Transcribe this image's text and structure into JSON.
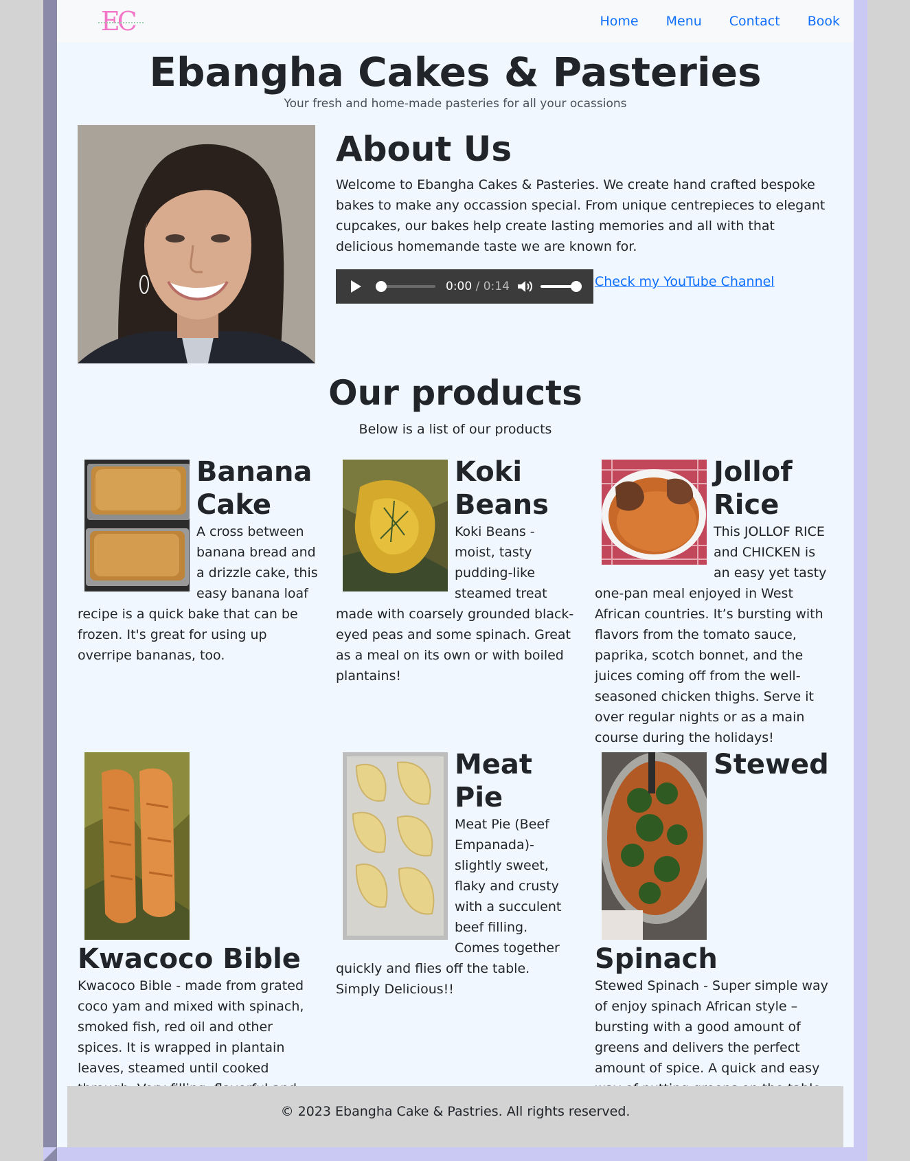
{
  "nav": {
    "logo_text": "EC",
    "links": [
      "Home",
      "Menu",
      "Contact",
      "Book"
    ]
  },
  "hero": {
    "title": "Ebangha Cakes & Pasteries",
    "subtitle": "Your fresh and home-made pasteries for all your ocassions"
  },
  "about": {
    "title": "About Us",
    "text": "Welcome to Ebangha Cakes & Pasteries. We create hand crafted bespoke bakes to make any occassion special. From unique centrepieces to elegant cupcakes, our bakes help create lasting memories and all with that delicious homemande taste we are known for.",
    "audio_current": "0:00",
    "audio_duration": "/ 0:14",
    "youtube_link": "Check my YouTube Channel"
  },
  "products": {
    "title": "Our products",
    "subtitle": "Below is a list of our products",
    "items": [
      {
        "name": "Banana Cake",
        "description": "A cross between banana bread and a drizzle cake, this easy banana loaf recipe is a quick bake that can be frozen. It's great for using up overripe bananas, too."
      },
      {
        "name": "Koki Beans",
        "description": "Koki Beans - moist, tasty pudding-like steamed treat made with coarsely grounded black-eyed peas and some spinach. Great as a meal on its own or with boiled plantains!"
      },
      {
        "name": "Jollof Rice",
        "description": "This JOLLOF RICE and CHICKEN is an easy yet tasty one-pan meal enjoyed in West African countries. It’s bursting with flavors from the tomato sauce, paprika, scotch bonnet, and the juices coming off from the well-seasoned chicken thighs. Serve it over regular nights or as a main course during the holidays!"
      },
      {
        "name": "Kwacoco Bible",
        "description": "Kwacoco Bible - made from grated coco yam and mixed with spinach, smoked fish, red oil and other spices. It is wrapped in plantain leaves, steamed until cooked through. Very filling, flavorful and aromatic side dish!"
      },
      {
        "name": "Meat Pie",
        "description": "Meat Pie (Beef Empanada)- slightly sweet, flaky and crusty with a succulent beef filling. Comes together quickly and flies off the table. Simply Delicious!!"
      },
      {
        "name": "Stewed Spinach",
        "description": "Stewed Spinach - Super simple way of enjoy spinach African style – bursting with a good amount of greens and delivers the perfect amount of spice. A quick and easy way of putting greens on the table."
      }
    ]
  },
  "footer": {
    "text": "© 2023 Ebangha Cake & Pastries. All rights reserved."
  }
}
